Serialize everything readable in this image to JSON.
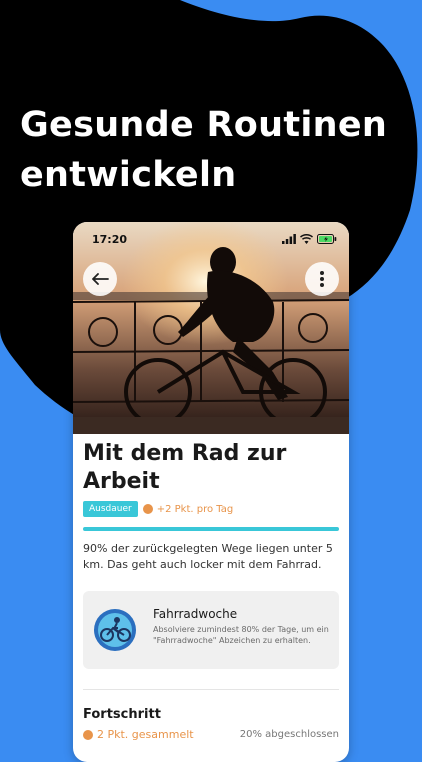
{
  "headline": {
    "line1": "Gesunde Routinen",
    "line2": "entwickeln"
  },
  "status_bar": {
    "time": "17:20"
  },
  "icons": {
    "back": "arrow-left-icon",
    "more": "more-vertical-icon",
    "badge": "bicycle-badge-icon",
    "points": "coin-icon"
  },
  "activity": {
    "title": "Mit dem Rad zur Arbeit",
    "tag": "Ausdauer",
    "points_per_day": "+2 Pkt. pro Tag",
    "description": "90% der zurückgelegten Wege liegen unter 5 km. Das geht auch locker mit dem Fahrrad."
  },
  "badge": {
    "title": "Fahrradwoche",
    "description": "Absolviere zumindest 80% der Tage, um ein \"Fahrradwoche\" Abzeichen zu erhalten."
  },
  "progress_section": {
    "title": "Fortschritt",
    "points_collected": "2 Pkt. gesammelt",
    "completed": "20% abgeschlossen"
  },
  "colors": {
    "accent": "#39c7d8",
    "points": "#e8944a",
    "background": "#3a8cf2"
  }
}
